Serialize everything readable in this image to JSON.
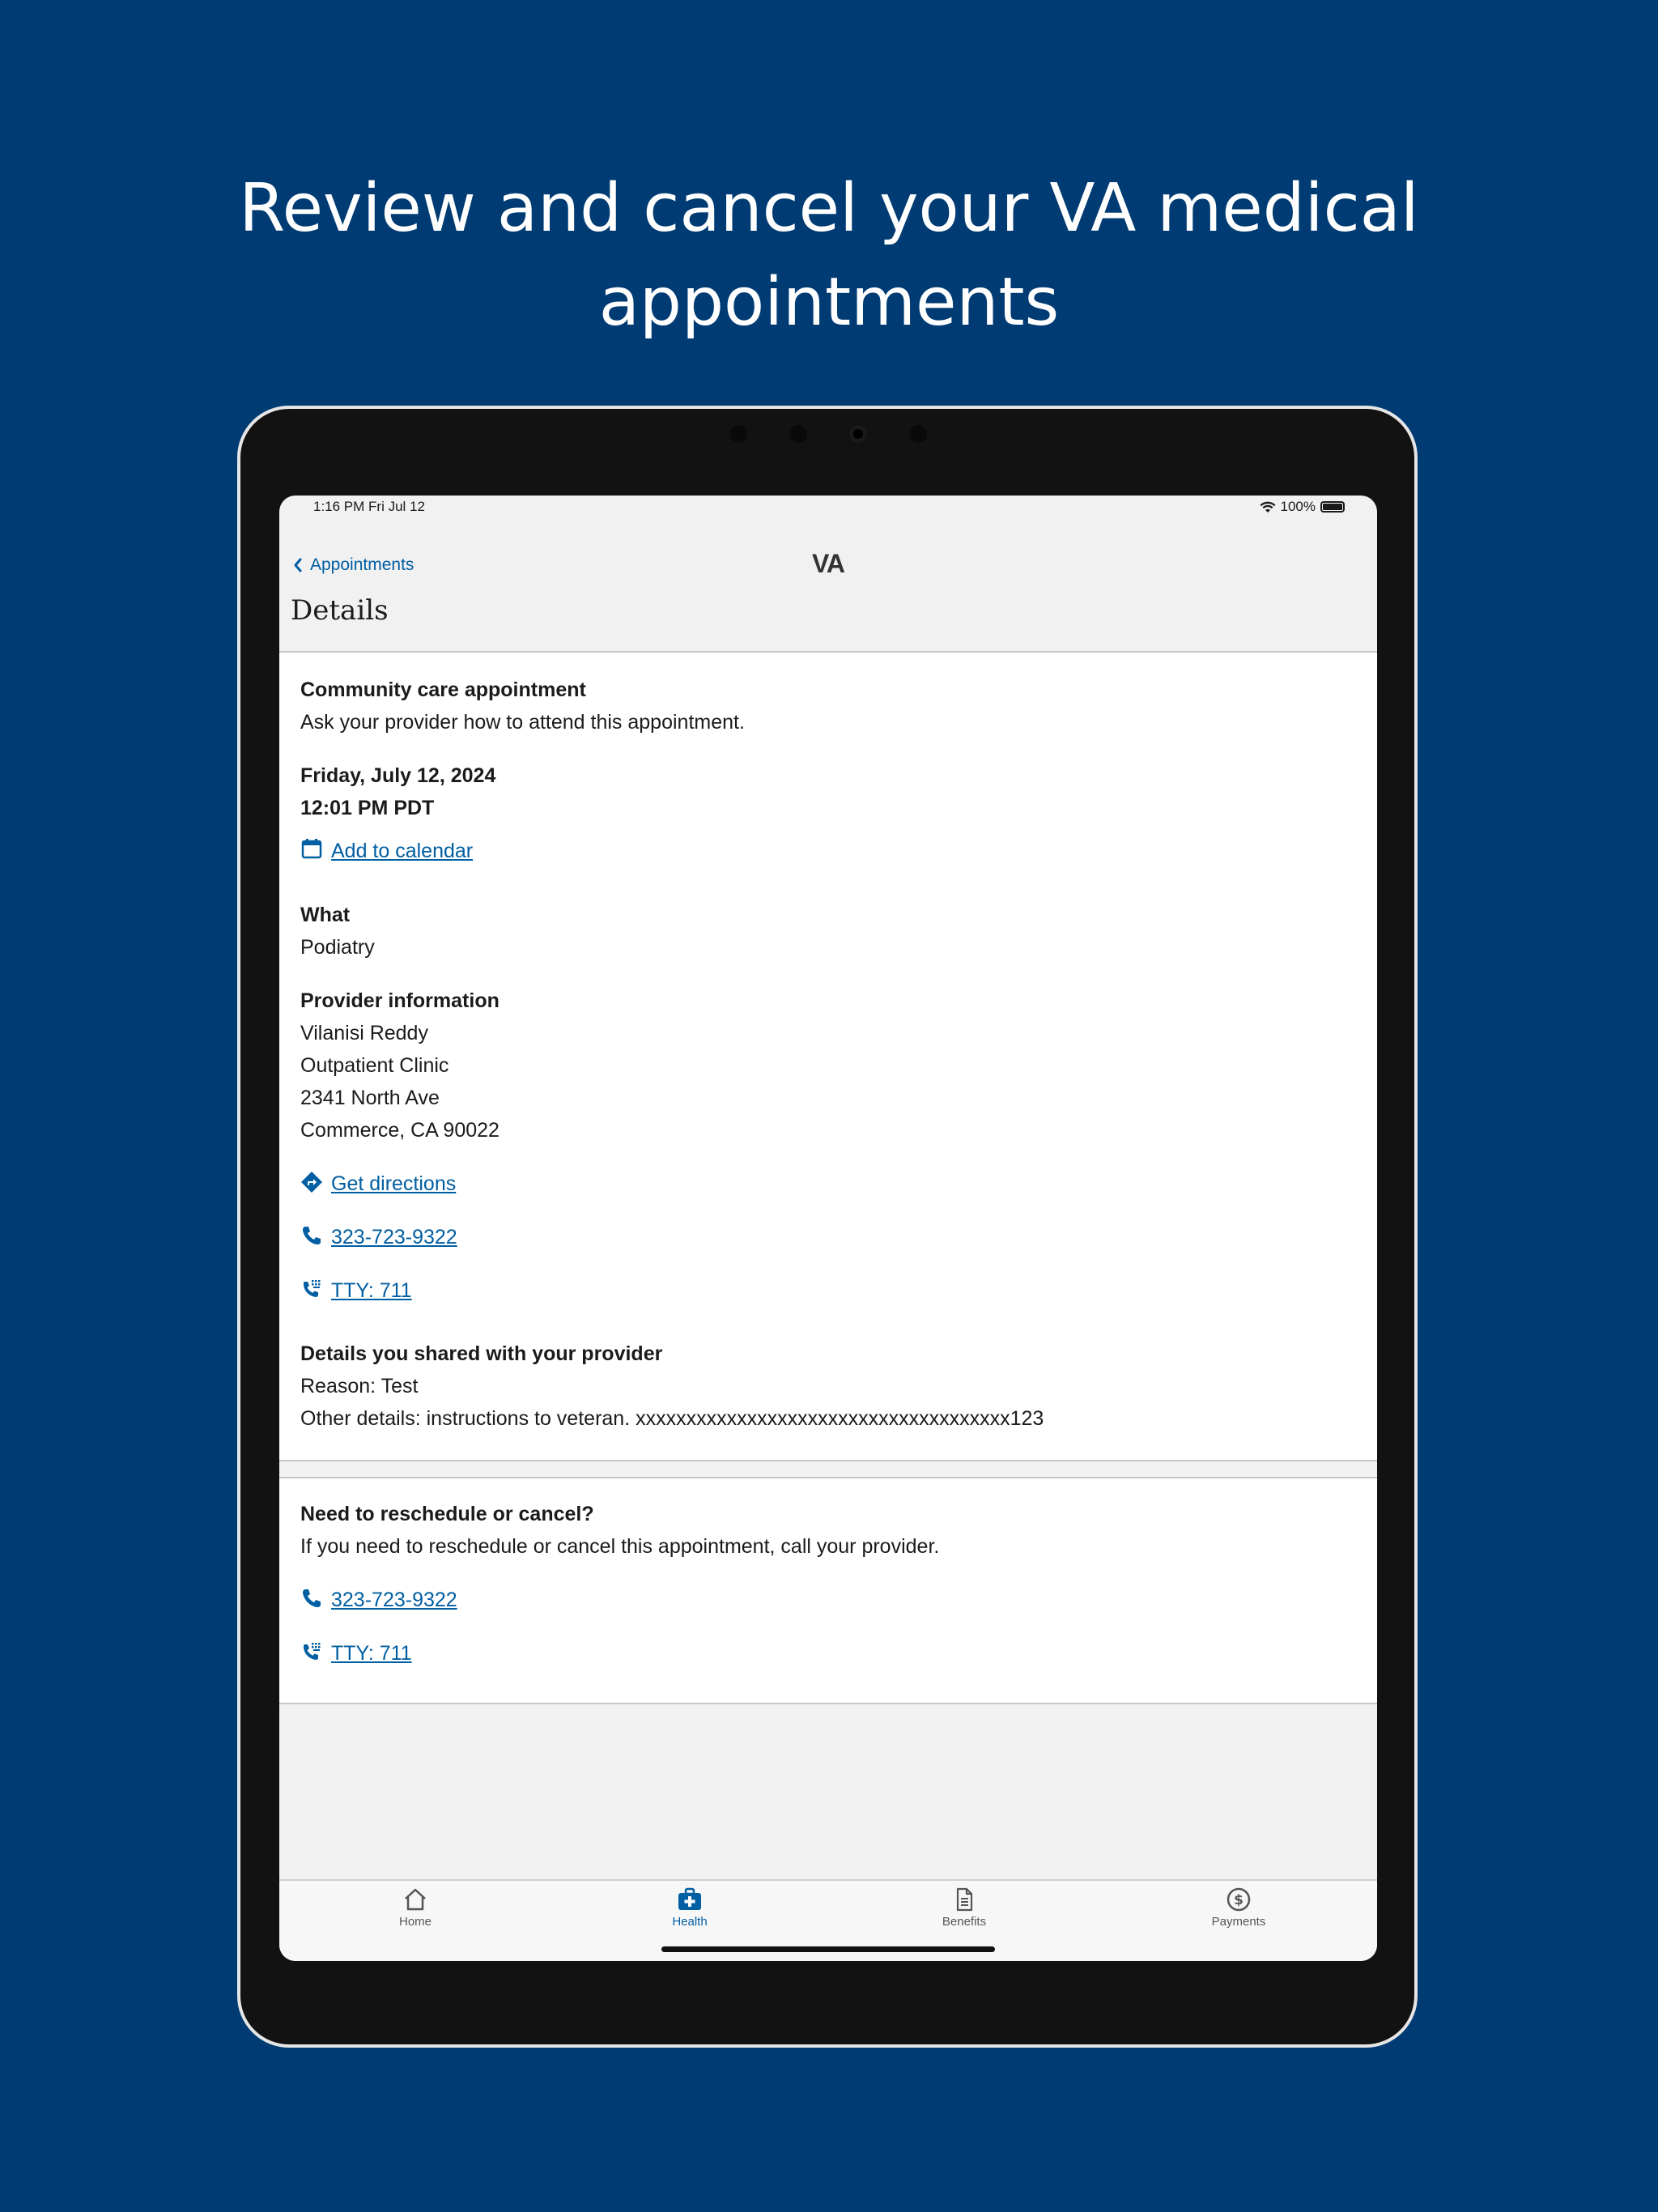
{
  "headline": "Review and cancel your  VA medical appointments",
  "status_bar": {
    "time": "1:16 PM   Fri Jul 12",
    "battery": "100%"
  },
  "nav": {
    "back_label": "Appointments",
    "logo": "VA",
    "title": "Details"
  },
  "appointment": {
    "type_heading": "Community care appointment",
    "type_note": "Ask your provider how to attend this appointment.",
    "date": "Friday, July 12, 2024",
    "time": "12:01 PM PDT",
    "add_to_calendar": "Add to calendar",
    "what_heading": "What",
    "what_value": "Podiatry",
    "provider_heading": "Provider information",
    "provider_name": "Vilanisi Reddy",
    "provider_facility": "Outpatient Clinic",
    "provider_street": "2341 North Ave",
    "provider_city": "Commerce, CA 90022",
    "directions_label": "Get directions",
    "phone_label": "323-723-9322",
    "tty_label": "TTY: 711",
    "shared_heading": "Details you shared with your provider",
    "reason": "Reason: Test",
    "other_details": "Other details: instructions to veteran.  xxxxxxxxxxxxxxxxxxxxxxxxxxxxxxxxxxxxx123"
  },
  "cancel_section": {
    "heading": "Need to reschedule or cancel?",
    "body": "If you need to reschedule or cancel this appointment, call your provider.",
    "phone_label": "323-723-9322",
    "tty_label": "TTY: 711"
  },
  "tabs": [
    {
      "label": "Home",
      "icon": "home-icon",
      "active": false
    },
    {
      "label": "Health",
      "icon": "medical-kit-icon",
      "active": true
    },
    {
      "label": "Benefits",
      "icon": "document-icon",
      "active": false
    },
    {
      "label": "Payments",
      "icon": "dollar-circle-icon",
      "active": false
    }
  ],
  "colors": {
    "background": "#003b73",
    "link": "#005ea2",
    "text": "#1b1b1b"
  }
}
